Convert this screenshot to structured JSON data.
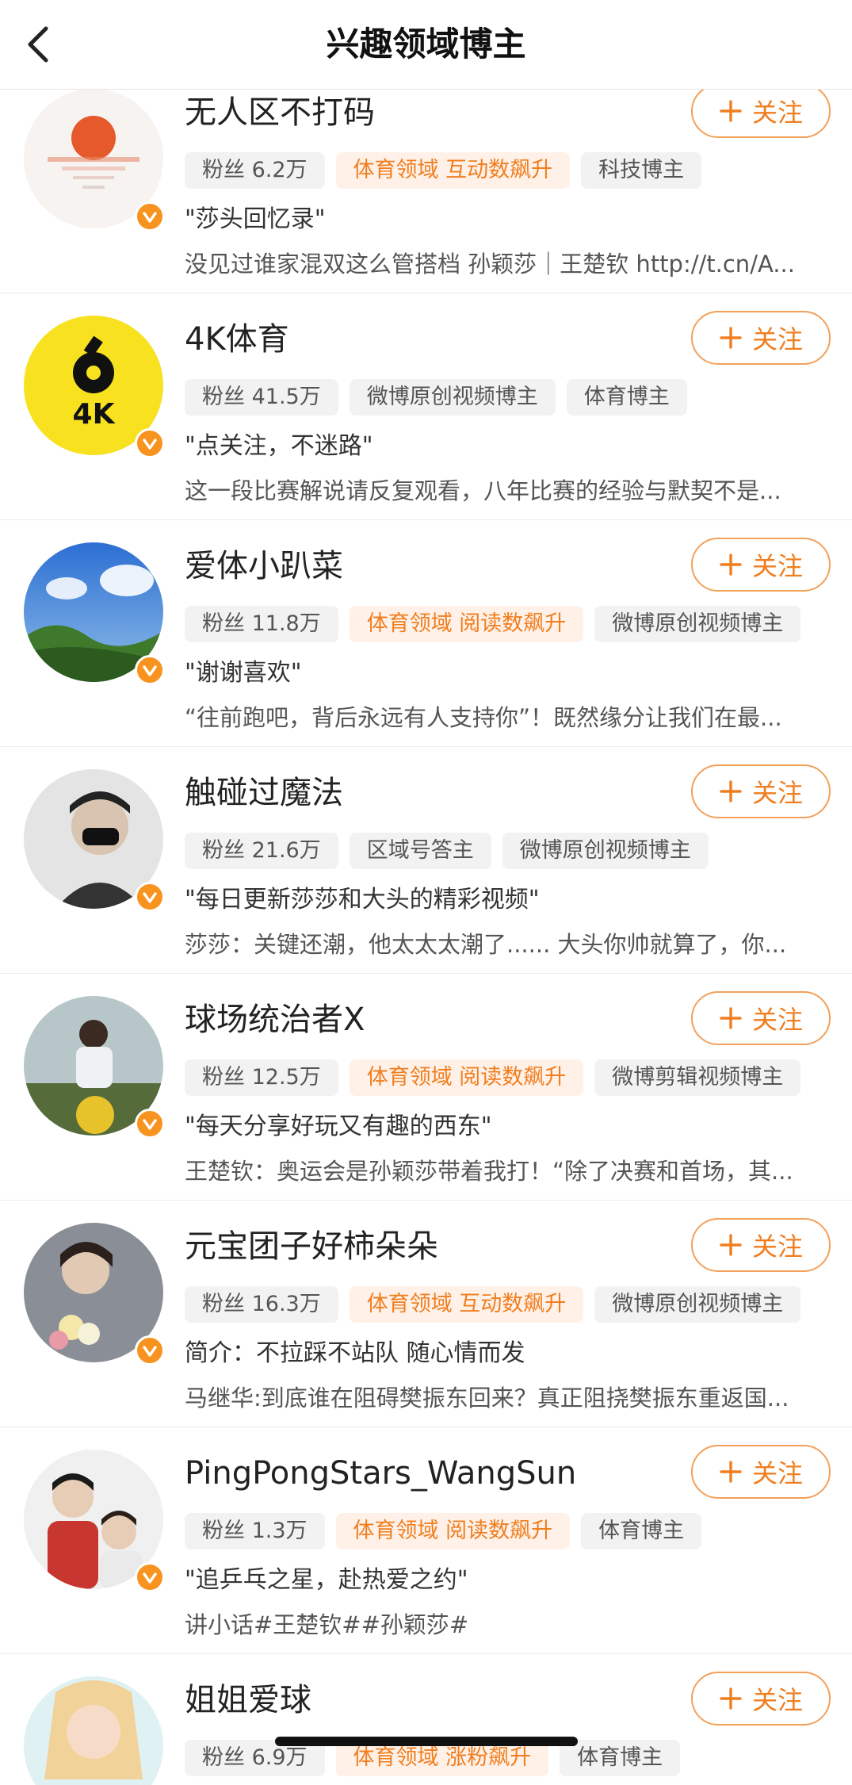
{
  "header": {
    "title": "兴趣领域博主"
  },
  "follow_label": "关注",
  "accent_color": "#f07e1f",
  "users": [
    {
      "name": "无人区不打码",
      "avatar": "sunset-reflection",
      "tags": [
        {
          "text": "粉丝 6.2万",
          "hot": false
        },
        {
          "text": "体育领域 互动数飙升",
          "hot": true
        },
        {
          "text": "科技博主",
          "hot": false
        }
      ],
      "desc": "\"莎头回忆录\"",
      "post": "没见过谁家混双这么管搭档 孙颖莎｜王楚钦 http://t.cn/A..."
    },
    {
      "name": "4K体育",
      "avatar": "4k-sports-logo",
      "tags": [
        {
          "text": "粉丝 41.5万",
          "hot": false
        },
        {
          "text": "微博原创视频博主",
          "hot": false
        },
        {
          "text": "体育博主",
          "hot": false
        }
      ],
      "desc": "\"点关注，不迷路\"",
      "post": "这一段比赛解说请反复观看，八年比赛的经验与默契不是..."
    },
    {
      "name": "爱体小趴菜",
      "avatar": "sky-and-trees",
      "tags": [
        {
          "text": "粉丝 11.8万",
          "hot": false
        },
        {
          "text": "体育领域 阅读数飙升",
          "hot": true
        },
        {
          "text": "微博原创视频博主",
          "hot": false
        }
      ],
      "desc": "\"谢谢喜欢\"",
      "post": "“往前跑吧，背后永远有人支持你”！既然缘分让我们在最..."
    },
    {
      "name": "触碰过魔法",
      "avatar": "masked-person",
      "tags": [
        {
          "text": "粉丝 21.6万",
          "hot": false
        },
        {
          "text": "区域号答主",
          "hot": false
        },
        {
          "text": "微博原创视频博主",
          "hot": false
        }
      ],
      "desc": "\"每日更新莎莎和大头的精彩视频\"",
      "post": "莎莎：关键还潮，他太太太潮了...... 大头你帅就算了，你..."
    },
    {
      "name": "球场统治者X",
      "avatar": "child-on-field",
      "tags": [
        {
          "text": "粉丝 12.5万",
          "hot": false
        },
        {
          "text": "体育领域 阅读数飙升",
          "hot": true
        },
        {
          "text": "微博剪辑视频博主",
          "hot": false
        }
      ],
      "desc": "\"每天分享好玩又有趣的西东\"",
      "post": "王楚钦：奥运会是孙颖莎带着我打！“除了决赛和首场，其..."
    },
    {
      "name": "元宝团子好柿朵朵",
      "avatar": "girl-with-flowers",
      "tags": [
        {
          "text": "粉丝 16.3万",
          "hot": false
        },
        {
          "text": "体育领域 互动数飙升",
          "hot": true
        },
        {
          "text": "微博原创视频博主",
          "hot": false
        }
      ],
      "desc": "简介：不拉踩不站队 随心情而发",
      "post": "马继华:到底谁在阻碍樊振东回来？真正阻挠樊振东重返国..."
    },
    {
      "name": "PingPongStars_WangSun",
      "avatar": "two-players",
      "tags": [
        {
          "text": "粉丝 1.3万",
          "hot": false
        },
        {
          "text": "体育领域 阅读数飙升",
          "hot": true
        },
        {
          "text": "体育博主",
          "hot": false
        }
      ],
      "desc": "\"追乒乓之星，赴热爱之约\"",
      "post": "讲小话#王楚钦##孙颖莎#"
    },
    {
      "name": "姐姐爱球",
      "avatar": "cartoon-girl",
      "tags": [
        {
          "text": "粉丝 6.9万",
          "hot": false
        },
        {
          "text": "体育领域 涨粉飙升",
          "hot": true
        },
        {
          "text": "体育博主",
          "hot": false
        }
      ],
      "desc": "",
      "post": ""
    }
  ]
}
